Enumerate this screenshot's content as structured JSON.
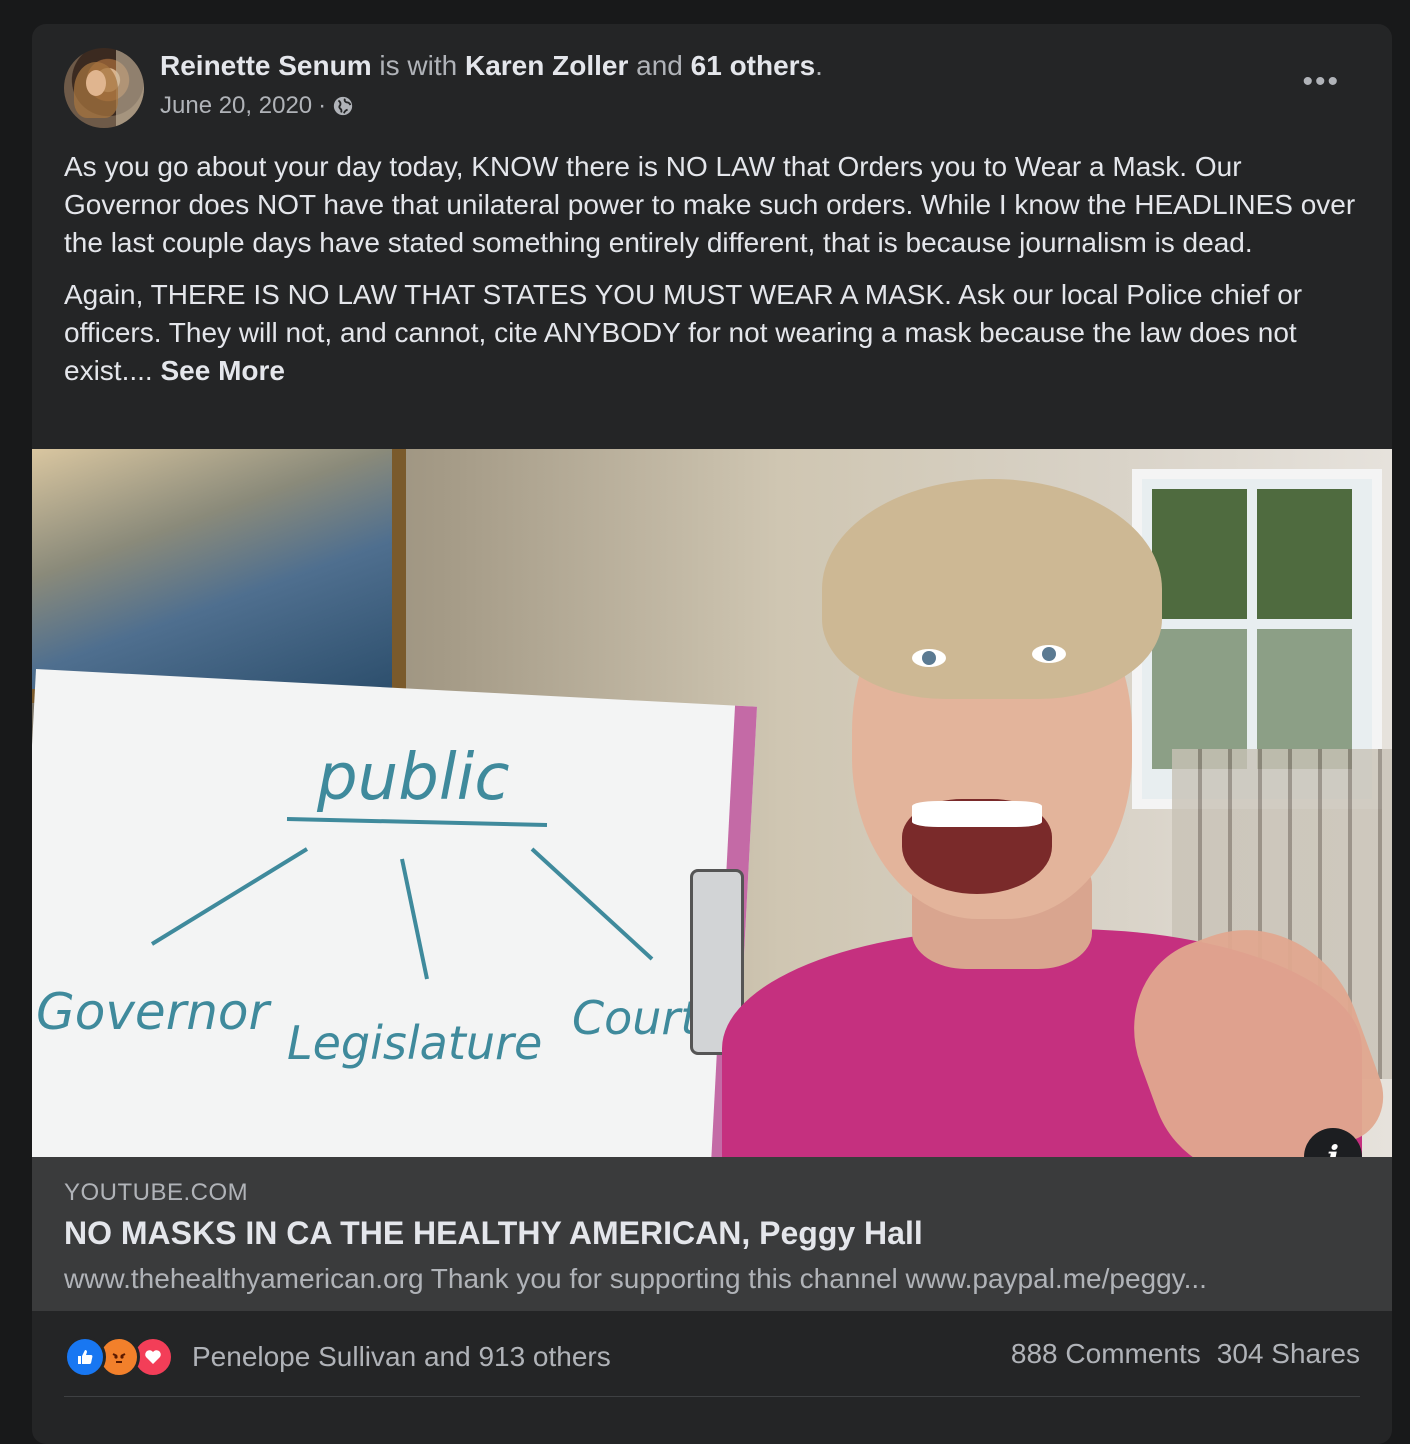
{
  "post": {
    "author": "Reinette Senum",
    "with_text": "is with",
    "tagged": "Karen Zoller",
    "and_text": "and",
    "others": "61 others",
    "end_punct": ".",
    "date": "June 20, 2020",
    "separator": "·",
    "privacy_icon": "globe-icon",
    "more_icon": "more-options-icon",
    "paragraph1": "As you go about your day today, KNOW there is NO LAW that Orders you to Wear a Mask. Our Governor does NOT have that unilateral power to make such orders. While I know the HEADLINES over the last couple days have stated something entirely different, that is because journalism is dead.",
    "paragraph2": "Again, THERE IS NO LAW THAT STATES YOU MUST WEAR A MASK. Ask our local Police chief or officers. They will not, and cannot, cite ANYBODY for not wearing a mask because the law does not exist....",
    "see_more": "See More"
  },
  "video": {
    "board_top": "public",
    "board_left": "Governor",
    "board_mid": "Legislature",
    "board_right": "Court",
    "info_label": "i"
  },
  "link": {
    "domain": "YOUTUBE.COM",
    "title": "NO MASKS IN CA THE HEALTHY AMERICAN, Peggy Hall",
    "description": "www.thehealthyamerican.org Thank you for supporting this channel www.paypal.me/peggy..."
  },
  "footer": {
    "reaction_icons": [
      "like-icon",
      "angry-icon",
      "love-icon"
    ],
    "reacted_by": "Penelope Sullivan and 913 others",
    "comments": "888 Comments",
    "shares": "304 Shares"
  },
  "colors": {
    "page_bg": "#18191a",
    "card_bg": "#242526",
    "link_bg": "#3a3b3c",
    "primary_text": "#e4e6eb",
    "secondary_text": "#b0b3b8",
    "like_blue": "#1877f2",
    "love_red": "#f33e58",
    "angry_orange": "#f2802b"
  }
}
